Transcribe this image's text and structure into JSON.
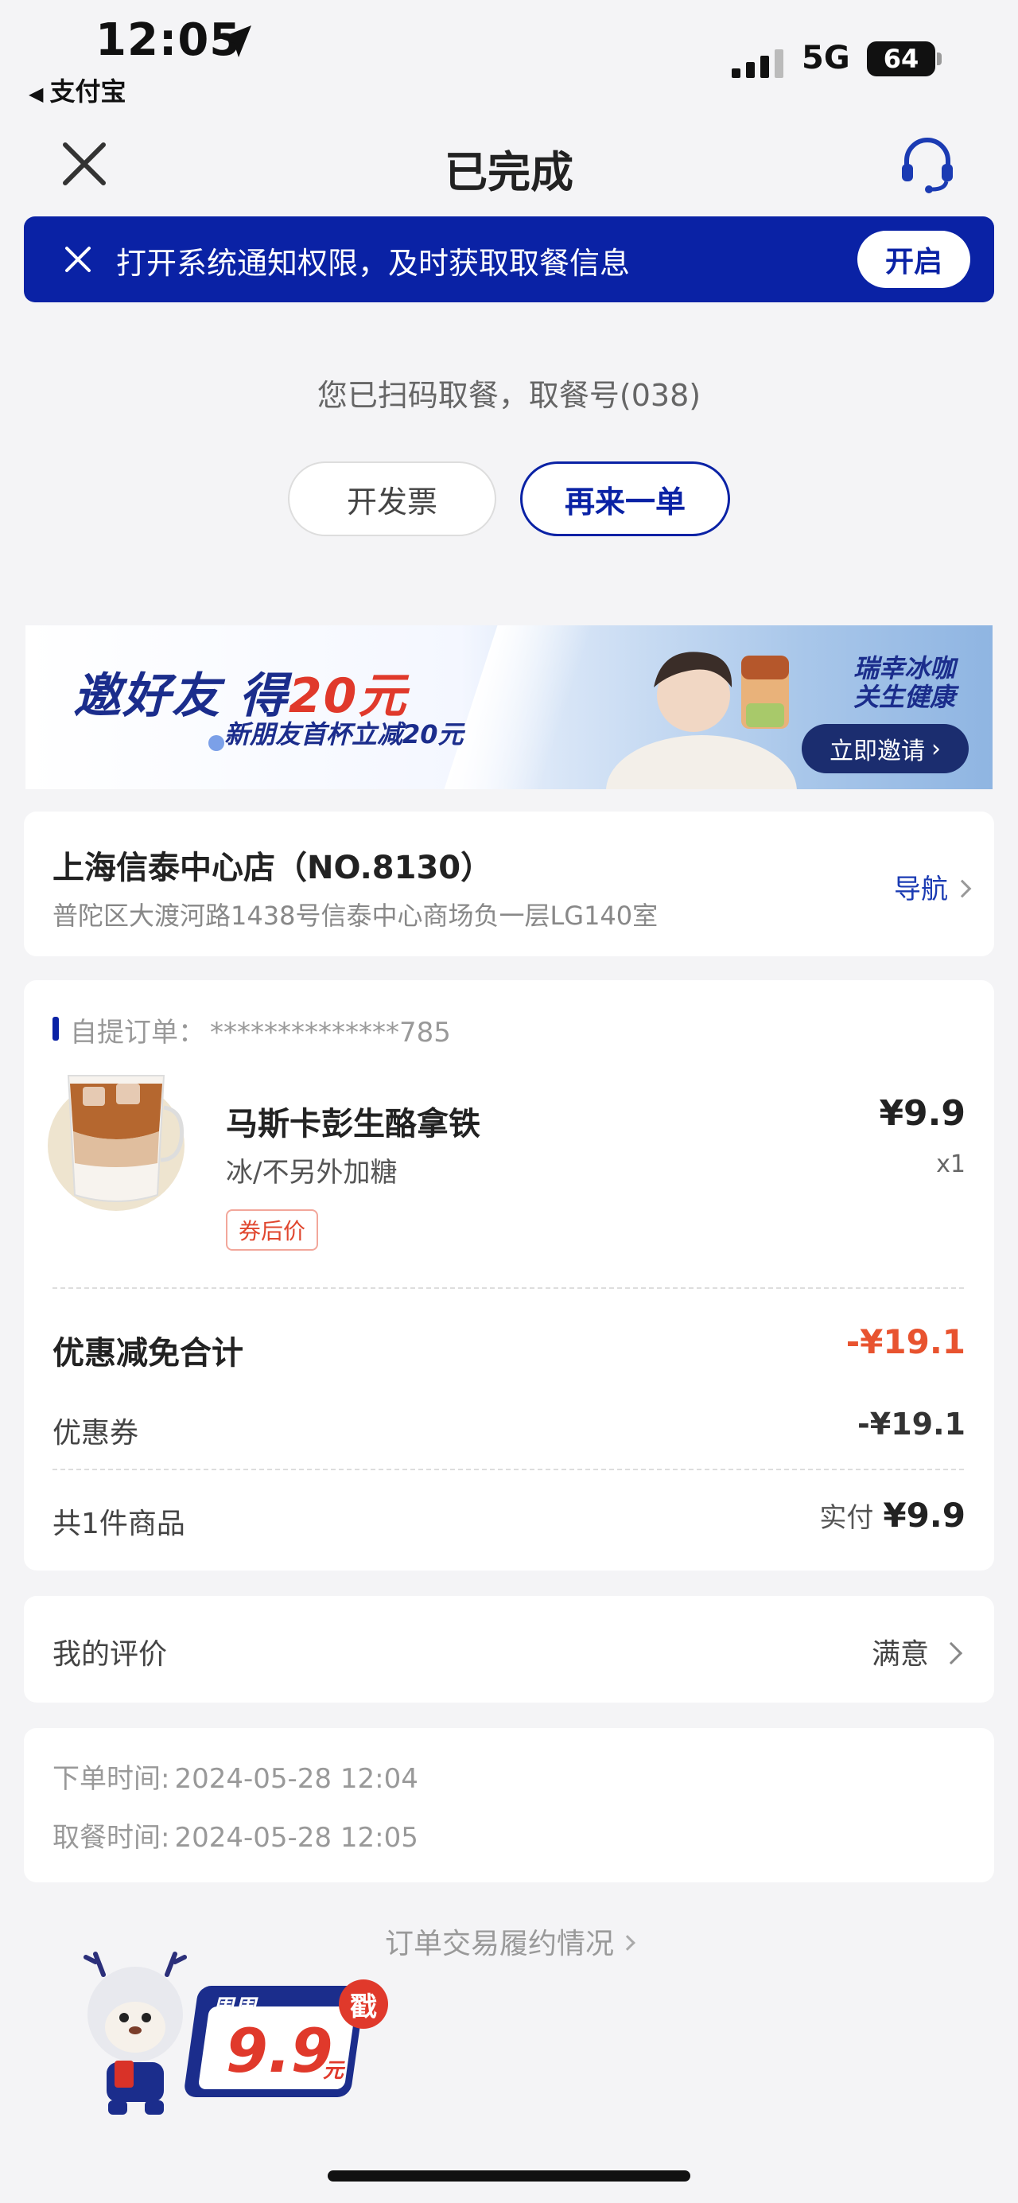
{
  "status_bar": {
    "time": "12:05",
    "back_app": "支付宝",
    "network": "5G",
    "battery": "64"
  },
  "header": {
    "title": "已完成"
  },
  "notification": {
    "text": "打开系统通知权限，及时获取取餐信息",
    "button": "开启"
  },
  "pickup": {
    "message": "您已扫码取餐，取餐号(038)",
    "invoice_button": "开发票",
    "reorder_button": "再来一单"
  },
  "promo": {
    "title_prefix": "邀好友 得",
    "title_amount": "20元",
    "subtitle": "新朋友首杯立减20元",
    "slogan": "瑞幸冰咖 关生健康",
    "button": "立即邀请"
  },
  "store": {
    "name": "上海信泰中心店（NO.8130）",
    "address": "普陀区大渡河路1438号信泰中心商场负一层LG140室",
    "nav": "导航"
  },
  "order": {
    "label": "自提订单：",
    "number": "**************785",
    "item": {
      "name": "马斯卡彭生酪拿铁",
      "spec": "冰/不另外加糖",
      "tag": "券后价",
      "price": "¥9.9",
      "qty": "x1"
    },
    "discount_title": "优惠减免合计",
    "discount_total": "-¥19.1",
    "coupon_label": "优惠券",
    "coupon_value": "-¥19.1",
    "count_label": "共1件商品",
    "paid_label": "实付",
    "paid_value": "¥9.9"
  },
  "review": {
    "label": "我的评价",
    "value": "满意"
  },
  "times": {
    "order_label": "下单时间:",
    "order_time": "2024-05-28 12:04",
    "pickup_label": "取餐时间:",
    "pickup_time": "2024-05-28 12:05"
  },
  "footer": {
    "link": "订单交易履约情况"
  },
  "mascot_badge": {
    "line1": "周周",
    "price": "9.9",
    "unit": "元",
    "stamp": "戳"
  },
  "colors": {
    "brand": "#0a22a5",
    "discount": "#e8532f",
    "background": "#f4f4f6"
  }
}
